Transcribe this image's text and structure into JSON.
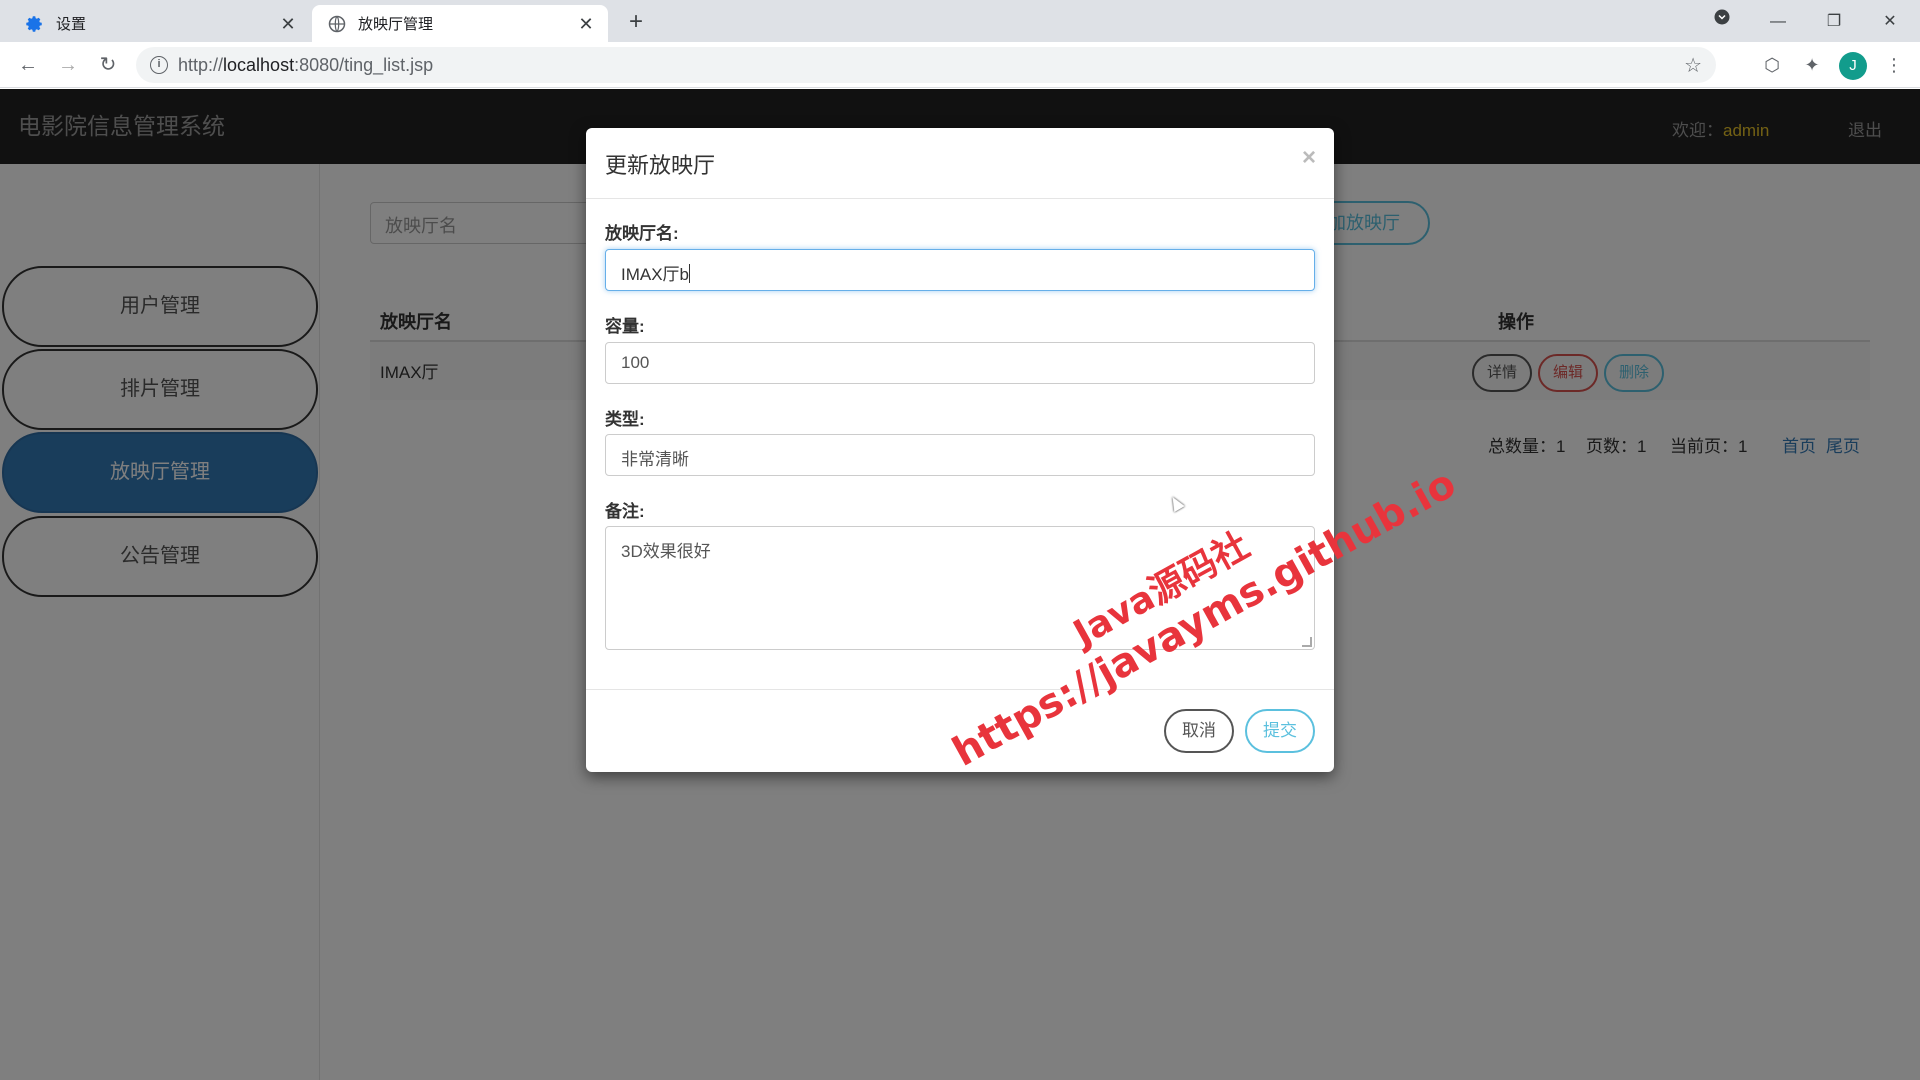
{
  "browser": {
    "tabs": [
      {
        "title": "设置",
        "icon": "gear-icon"
      },
      {
        "title": "放映厅管理",
        "icon": "globe-icon"
      }
    ],
    "url_host": "localhost",
    "url_prefix": "http://",
    "url_rest": ":8080/ting_list.jsp",
    "avatar_letter": "J"
  },
  "app": {
    "brand": "电影院信息管理系统",
    "welcome_label": "欢迎：",
    "username": "admin",
    "logout": "退出"
  },
  "sidebar": {
    "items": [
      {
        "label": "用户管理",
        "active": false
      },
      {
        "label": "排片管理",
        "active": false
      },
      {
        "label": "放映厅管理",
        "active": true
      },
      {
        "label": "公告管理",
        "active": false
      }
    ]
  },
  "list": {
    "search_placeholder": "放映厅名",
    "add_button": "添加放映厅",
    "columns": {
      "name": "放映厅名",
      "ops": "操作"
    },
    "rows": [
      {
        "name": "IMAX厅",
        "detail": "详情",
        "edit": "编辑",
        "delete": "删除"
      }
    ],
    "pager": {
      "total": "总数量：1",
      "pages": "页数：1",
      "current": "当前页：1",
      "first": "首页",
      "last": "尾页"
    }
  },
  "modal": {
    "title": "更新放映厅",
    "close": "×",
    "fields": {
      "name_label": "放映厅名:",
      "name_value": "IMAX厅b",
      "capacity_label": "容量:",
      "capacity_value": "100",
      "type_label": "类型:",
      "type_value": "非常清晰",
      "remark_label": "备注:",
      "remark_value": "3D效果很好"
    },
    "cancel": "取消",
    "submit": "提交"
  },
  "watermark": {
    "line1": "Java源码社",
    "line2": "https://javayms.github.io"
  },
  "colors": {
    "header_bg": "#222222",
    "active_nav": "#337ab7",
    "info": "#5bc0de",
    "danger": "#d9534f",
    "username": "#e6c229",
    "watermark": "#e8343c"
  }
}
